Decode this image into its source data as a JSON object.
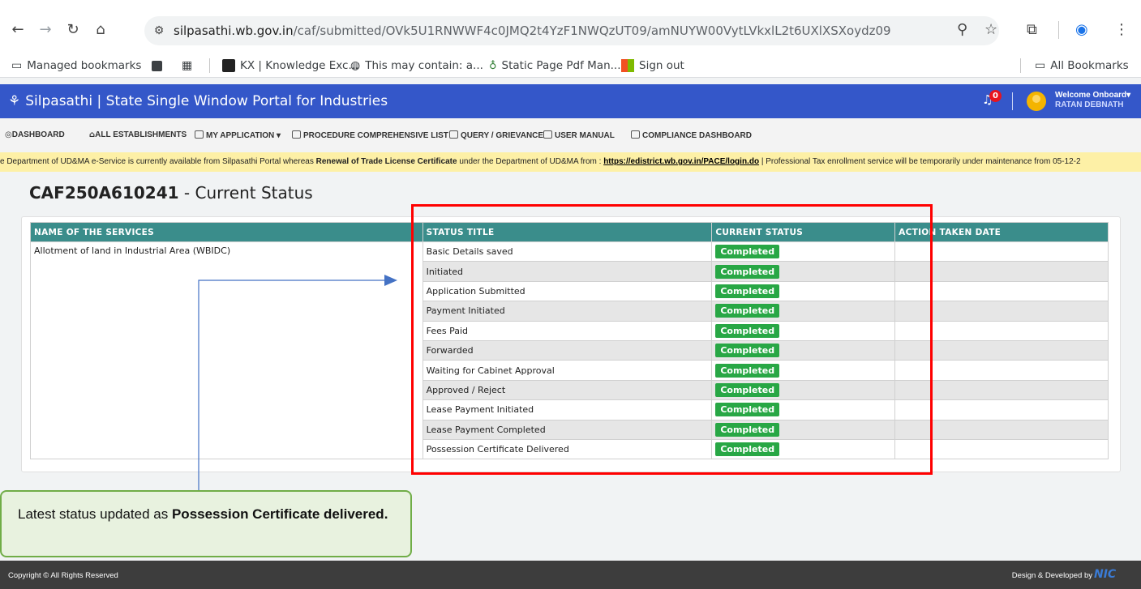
{
  "browser": {
    "url_host": "silpasathi.wb.gov.in",
    "url_path": "/caf/submitted/OVk5U1RNWWF4c0JMQ2t4YzF1NWQzUT09/amNUYW00VytLVkxlL2t6UXlXSXoydz09",
    "bookmarks": [
      {
        "label": "Managed bookmarks"
      },
      {
        "label": ""
      },
      {
        "label": ""
      },
      {
        "label": "KX | Knowledge Exc..."
      },
      {
        "label": "This may contain: a..."
      },
      {
        "label": "Static Page Pdf Man..."
      },
      {
        "label": "Sign out"
      }
    ],
    "all_bookmarks": "All Bookmarks"
  },
  "header": {
    "title": "Silpasathi | State Single Window Portal for Industries",
    "notification_count": "0",
    "welcome": "Welcome Onboard",
    "user": "RATAN DEBNATH"
  },
  "menu": [
    "DASHBOARD",
    "ALL ESTABLISHMENTS",
    "MY APPLICATION",
    "PROCEDURE COMPREHENSIVE LIST",
    "QUERY / GRIEVANCE",
    "USER MANUAL",
    "COMPLIANCE DASHBOARD"
  ],
  "marquee": {
    "part1": "e Department of UD&MA e-Service is currently available from Silpasathi Portal whereas ",
    "bold1": "Renewal of Trade License Certificate",
    "part2": " under the Department of UD&MA from : ",
    "link": "https://edistrict.wb.gov.in/PACE/login.do",
    "part3": "    |    Professional Tax enrollment service will be temporarily under maintenance from 05-12-2"
  },
  "page": {
    "caf_id": "CAF250A610241",
    "title_suffix": " - Current Status"
  },
  "table": {
    "headers": [
      "NAME OF THE SERVICES",
      "STATUS TITLE",
      "CURRENT STATUS",
      "ACTION TAKEN DATE"
    ],
    "service": "Allotment of land in Industrial Area (WBIDC)",
    "rows": [
      {
        "title": "Basic Details saved",
        "status": "Completed",
        "date": ""
      },
      {
        "title": "Initiated",
        "status": "Completed",
        "date": ""
      },
      {
        "title": "Application Submitted",
        "status": "Completed",
        "date": ""
      },
      {
        "title": "Payment Initiated",
        "status": "Completed",
        "date": ""
      },
      {
        "title": "Fees Paid",
        "status": "Completed",
        "date": ""
      },
      {
        "title": "Forwarded",
        "status": "Completed",
        "date": ""
      },
      {
        "title": "Waiting for Cabinet Approval",
        "status": "Completed",
        "date": ""
      },
      {
        "title": "Approved / Reject",
        "status": "Completed",
        "date": ""
      },
      {
        "title": "Lease Payment Initiated",
        "status": "Completed",
        "date": ""
      },
      {
        "title": "Lease Payment Completed",
        "status": "Completed",
        "date": ""
      },
      {
        "title": "Possession Certificate Delivered",
        "status": "Completed",
        "date": ""
      }
    ]
  },
  "callout": {
    "prefix": "Latest status updated as ",
    "bold": "Possession Certificate delivered."
  },
  "footer": {
    "copyright": "Copyright © All Rights Reserved",
    "design": "Design & Developed by",
    "nic": "NIC"
  },
  "colors": {
    "header_blue": "#3457c9",
    "table_header_teal": "#3a8d8b",
    "status_green": "#28a745",
    "highlight_red": "#ff0000",
    "callout_green": "#70ad47"
  }
}
